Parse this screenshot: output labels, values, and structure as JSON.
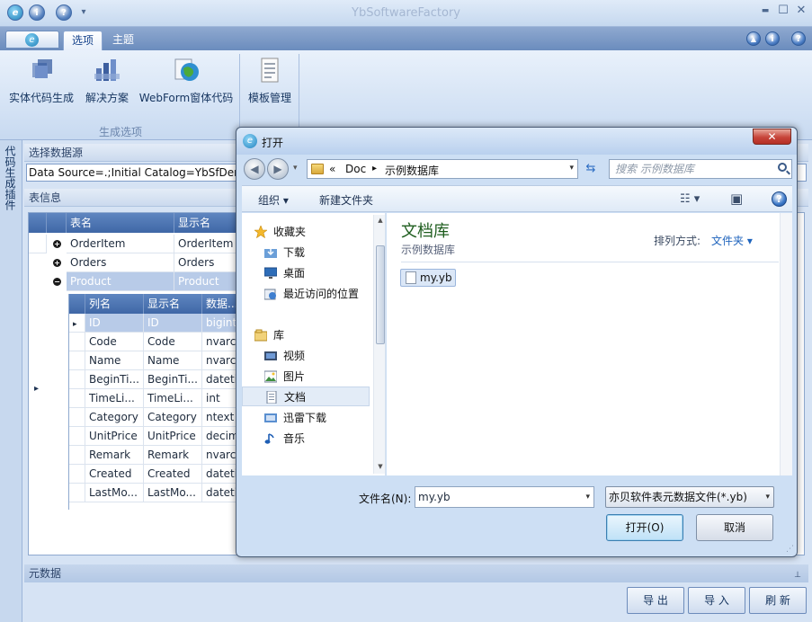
{
  "window": {
    "title": "YbSoftwareFactory",
    "min_glyph": "▬",
    "max_glyph": "☐",
    "close_glyph": "✕"
  },
  "qat": {
    "app_icon": "app-logo-icon",
    "info_glyph": "i",
    "help_glyph": "?",
    "dropdown_glyph": "▾",
    "logo_glyph": "e"
  },
  "tabs": [
    {
      "label": "选项",
      "active": true
    },
    {
      "label": "主题",
      "active": false
    }
  ],
  "tab_right_icons": {
    "up_glyph": "▲",
    "info_glyph": "i",
    "help_glyph": "?"
  },
  "ribbon": {
    "buttons": [
      {
        "label": "实体代码生成",
        "icon": "entity-code-icon"
      },
      {
        "label": "解决方案",
        "icon": "solution-icon"
      },
      {
        "label": "WebForm窗体代码",
        "icon": "webform-globe-icon"
      },
      {
        "label": "模板管理",
        "icon": "template-icon"
      }
    ],
    "group_label": "生成选项"
  },
  "sidebar": {
    "label": "代码生成插件"
  },
  "datasource": {
    "caption": "选择数据源",
    "value": "Data Source=.;Initial Catalog=YbSfDemo"
  },
  "tableinfo": {
    "caption": "表信息",
    "headers": [
      "表名",
      "显示名"
    ],
    "rows": [
      {
        "name": "OrderItem",
        "display": "OrderItem",
        "expander": "+"
      },
      {
        "name": "Orders",
        "display": "Orders",
        "expander": "+"
      },
      {
        "name": "Product",
        "display": "Product",
        "expander": "−"
      }
    ],
    "sub_headers": [
      "列名",
      "显示名",
      "数据..."
    ],
    "sub_rows": [
      {
        "col": "ID",
        "display": "ID",
        "type": "bigint"
      },
      {
        "col": "Code",
        "display": "Code",
        "type": "nvarchar"
      },
      {
        "col": "Name",
        "display": "Name",
        "type": "nvarchar"
      },
      {
        "col": "BeginTi...",
        "display": "BeginTi...",
        "type": "datetime"
      },
      {
        "col": "TimeLi...",
        "display": "TimeLi...",
        "type": "int"
      },
      {
        "col": "Category",
        "display": "Category",
        "type": "ntext"
      },
      {
        "col": "UnitPrice",
        "display": "UnitPrice",
        "type": "decimal"
      },
      {
        "col": "Remark",
        "display": "Remark",
        "type": "nvarchar"
      },
      {
        "col": "Created",
        "display": "Created",
        "type": "datetime"
      },
      {
        "col": "LastMo...",
        "display": "LastMo...",
        "type": "datetime"
      }
    ],
    "row_pointer": "▸"
  },
  "metadata": {
    "caption": "元数据",
    "pin_glyph": "⊥"
  },
  "bottom_buttons": {
    "export": "导 出",
    "import": "导 入",
    "refresh": "刷 新"
  },
  "dialog": {
    "title": "打开",
    "logo_glyph": "e",
    "close_glyph": "✕",
    "back_glyph": "◀",
    "forward_glyph": "▶",
    "history_glyph": "▾",
    "address": {
      "prefix": "«",
      "part1": "Doc",
      "separator": "▸",
      "part2": "示例数据库",
      "caret": "▾"
    },
    "refresh_glyph": "⇆",
    "search_placeholder": "搜索 示例数据库",
    "toolbar": {
      "organize": "组织 ▾",
      "new_folder": "新建文件夹",
      "view_glyph": "☷ ▾",
      "pane_glyph": "▣",
      "help_glyph": "?"
    },
    "nav": {
      "favorites": {
        "label": "收藏夹",
        "icon": "star-icon"
      },
      "favorite_items": [
        {
          "label": "下载",
          "icon": "download-folder-icon"
        },
        {
          "label": "桌面",
          "icon": "desktop-icon"
        },
        {
          "label": "最近访问的位置",
          "icon": "recent-places-icon"
        }
      ],
      "libraries": {
        "label": "库",
        "icon": "library-icon"
      },
      "library_items": [
        {
          "label": "视频",
          "icon": "video-icon"
        },
        {
          "label": "图片",
          "icon": "picture-icon"
        },
        {
          "label": "文档",
          "icon": "document-icon",
          "selected": true
        },
        {
          "label": "迅雷下载",
          "icon": "thunder-download-icon"
        },
        {
          "label": "音乐",
          "icon": "music-icon"
        }
      ],
      "scroll_up": "▲",
      "scroll_down": "▼"
    },
    "library": {
      "title": "文档库",
      "subtitle": "示例数据库",
      "sort_label": "排列方式:",
      "sort_value": "文件夹 ▾"
    },
    "files": [
      {
        "name": "my.yb"
      }
    ],
    "filename_label": "文件名(N):",
    "filename_value": "my.yb",
    "filter_value": "亦贝软件表元数据文件(*.yb)",
    "open_button": "打开(O)",
    "cancel_button": "取消",
    "grip_glyph": "⋰"
  }
}
